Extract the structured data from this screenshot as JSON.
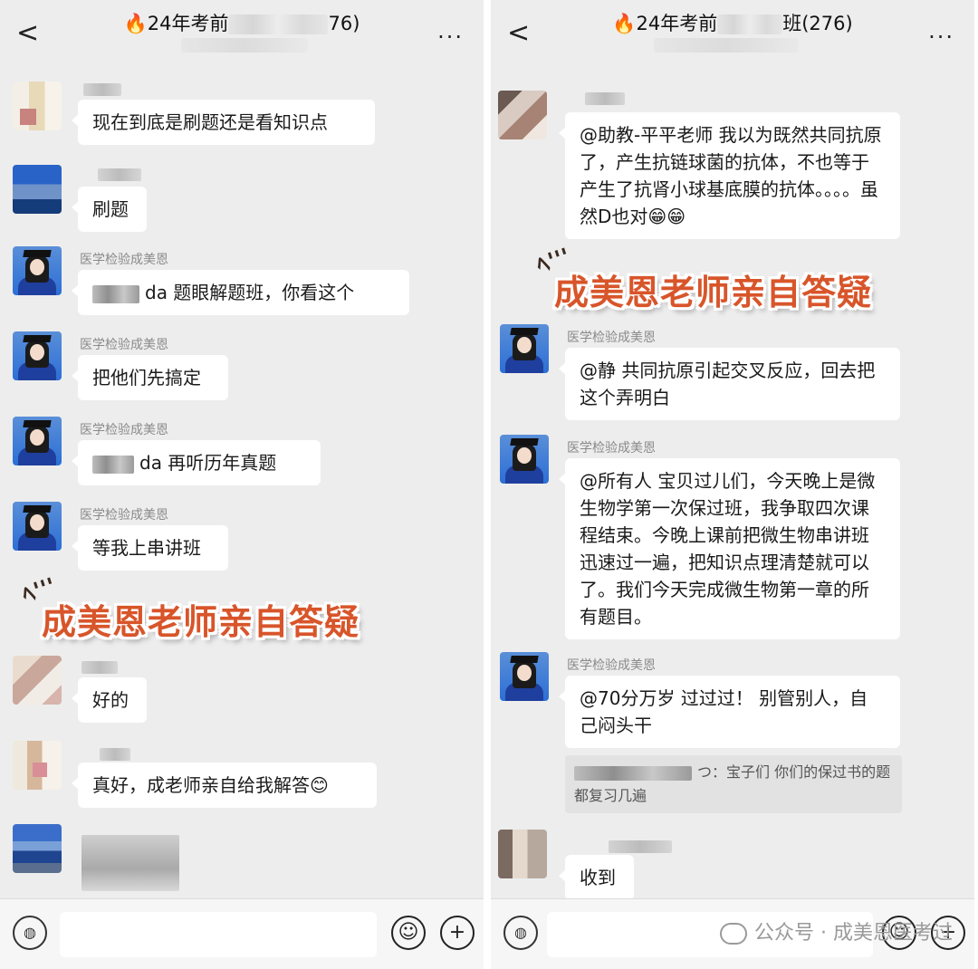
{
  "left": {
    "title_prefix": "24年考前",
    "title_suffix": "76)",
    "back_glyph": "<",
    "more_glyph": "...",
    "messages": [
      {
        "text": "现在到底是刷题还是看知识点"
      },
      {
        "text": "刷题"
      },
      {
        "sender": "医学检验成美恩",
        "text": "da  题眼解题班，你看这个"
      },
      {
        "sender": "医学检验成美恩",
        "text": "把他们先搞定"
      },
      {
        "sender": "医学检验成美恩",
        "text": "da  再听历年真题"
      },
      {
        "sender": "医学检验成美恩",
        "text": "等我上串讲班"
      },
      {
        "text": "好的"
      },
      {
        "text": "真好，成老师亲自给我解答😊"
      }
    ],
    "banner": "成美恩老师亲自答疑",
    "spark": "ﾍ'''",
    "input": {
      "placeholder": ""
    },
    "voice_glyph": "◍",
    "emoji_glyph": "☺",
    "plus_glyph": "+"
  },
  "right": {
    "title_prefix": "24年考前",
    "title_suffix": "班(276)",
    "back_glyph": "<",
    "more_glyph": "...",
    "messages": [
      {
        "text": "@助教-平平老师  我以为既然共同抗原了，产生抗链球菌的抗体，不也等于产生了抗肾小球基底膜的抗体。。。。虽然D也对😁😁"
      },
      {
        "sender": "医学检验成美恩",
        "text": "@静  共同抗原引起交叉反应，回去把这个弄明白"
      },
      {
        "sender": "医学检验成美恩",
        "text": "@所有人  宝贝过儿们，今天晚上是微生物学第一次保过班，我争取四次课程结束。今晚上课前把微生物串讲班迅速过一遍，把知识点理清楚就可以了。我们今天完成微生物第一章的所有题目。"
      },
      {
        "sender": "医学检验成美恩",
        "text": "@70分万岁 过过过！  别管别人，自己闷头干"
      },
      {
        "text": "收到"
      }
    ],
    "quote": "つ：宝子们 你们的保过书的题都复习几遍",
    "banner": "成美恩老师亲自答疑",
    "spark": "ﾍ'''",
    "input": {
      "placeholder": ""
    },
    "voice_glyph": "◍",
    "emoji_glyph": "☺",
    "plus_glyph": "+",
    "watermark": "公众号 · 成美恩医考过"
  },
  "fire_glyph": "🔥",
  "colors": {
    "banner": "#d8552a",
    "background": "#ededed",
    "bubble": "#ffffff"
  }
}
